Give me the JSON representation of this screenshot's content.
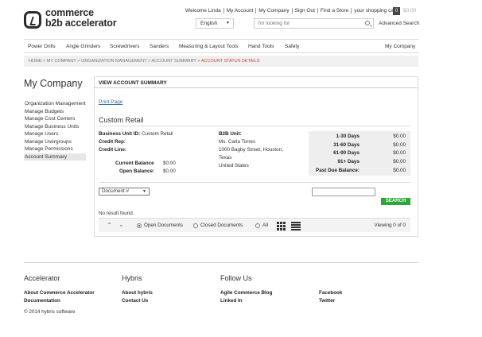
{
  "header": {
    "logo_line1": "commerce",
    "logo_line2": "b2b accelerator",
    "util": [
      "Welcome Linda",
      "My Account",
      "My Company",
      "Sign Out",
      "Find a Store",
      "your shopping cart"
    ],
    "cart_count": "0",
    "cart_total": "$0.00",
    "language": "English",
    "search_placeholder": "I'm looking for",
    "advanced_search": "Advanced Search"
  },
  "nav": {
    "items": [
      "Power Drills",
      "Angle Grinders",
      "Screwdrivers",
      "Sanders",
      "Measuring & Layout Tools",
      "Hand Tools",
      "Safety"
    ],
    "my_company": "My Company"
  },
  "breadcrumb": {
    "items": [
      "HOME",
      "MY COMPANY",
      "ORGANIZATION MANAGEMENT",
      "ACCOUNT SUMMARY"
    ],
    "separator": ">",
    "active": "ACCOUNT STATUS DETAILS"
  },
  "sidebar": {
    "title": "My Company",
    "items": [
      "Organization Management",
      "Manage Budgets",
      "Manage Cost Centers",
      "Manage Business Units",
      "Manage Users",
      "Manage Usergroups",
      "Manage Permissions",
      "Account Summary"
    ]
  },
  "main": {
    "title": "VIEW ACCOUNT SUMMARY",
    "print": "Print Page",
    "unit_name": "Custom Retail",
    "business_unit_id_label": "Business Unit ID:",
    "business_unit_id": "Custom Retail",
    "credit_rep_label": "Credit Rep:",
    "credit_line_label": "Credit Line:",
    "current_balance_label": "Current Balance",
    "current_balance": "$0.00",
    "open_balance_label": "Open Balance:",
    "open_balance": "$0.00",
    "b2b_unit_label": "B2B Unit:",
    "address": [
      "Ms. Carla Torres",
      "1000 Bagby Street, Houston,",
      "Texas",
      "United States"
    ],
    "aging": [
      {
        "k": "1-30 Days",
        "v": "$0.00"
      },
      {
        "k": "31-60 Days",
        "v": "$0.00"
      },
      {
        "k": "61-90 Days",
        "v": "$0.00"
      },
      {
        "k": "91+ Days",
        "v": "$0.00"
      },
      {
        "k": "Past Due Balance:",
        "v": "$0.00"
      }
    ],
    "doc_select": "Document #",
    "search_button": "SEARCH",
    "no_result": "No result found.",
    "filters": [
      "Open Documents",
      "Closed Documents",
      "All"
    ],
    "viewing": "Viewing 0 of 0"
  },
  "footer": {
    "col1_title": "Accelerator",
    "col1_links": [
      "About Commerce Accelerator",
      "Documentation"
    ],
    "col2_title": "Hybris",
    "col2_links": [
      "About hybris",
      "Contact Us"
    ],
    "col3_title": "Follow Us",
    "col3_links": [
      "Agile Commerce Blog",
      "Linked In"
    ],
    "col4_links": [
      "Facebook",
      "Twitter"
    ],
    "copyright": "© 2014 hybris software"
  },
  "colors": {
    "accent_green": "#2aa837",
    "breadcrumb_active": "#c8473b",
    "link_blue": "#3b6fa0"
  }
}
